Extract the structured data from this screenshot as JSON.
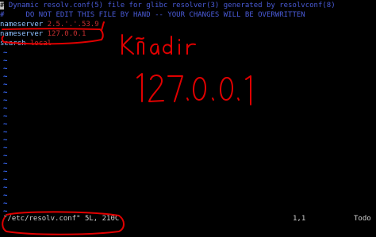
{
  "editor": {
    "lines": [
      {
        "type": "comment",
        "cursor": "#",
        "text": " Dynamic resolv.conf(5) file for glibc resolver(3) generated by resolvconf(8)"
      },
      {
        "type": "comment",
        "text": "#     DO NOT EDIT THIS FILE BY HAND -- YOUR CHANGES WILL BE OVERWRITTEN"
      },
      {
        "type": "entry",
        "key": "nameserver",
        "value": "2.5.'.'.53.9"
      },
      {
        "type": "entry",
        "key": "nameserver",
        "value": "127.0.0.1"
      },
      {
        "type": "entry",
        "key": "search",
        "value": "local"
      }
    ],
    "tilde_char": "~",
    "tilde_count": 21
  },
  "status": {
    "file_info": "\"/etc/resolv.conf\" 5L, 210C",
    "position": "1,1",
    "scroll": "Todo"
  },
  "annotations": {
    "handwritten_word": "Kñadır",
    "handwritten_ip": "127.0.0.1",
    "color": "#e00000"
  },
  "colors": {
    "background": "#000000",
    "comment": "#4a5bd8",
    "key": "#8ec0ff",
    "value": "#c83030",
    "tilde": "#3a6cff"
  }
}
